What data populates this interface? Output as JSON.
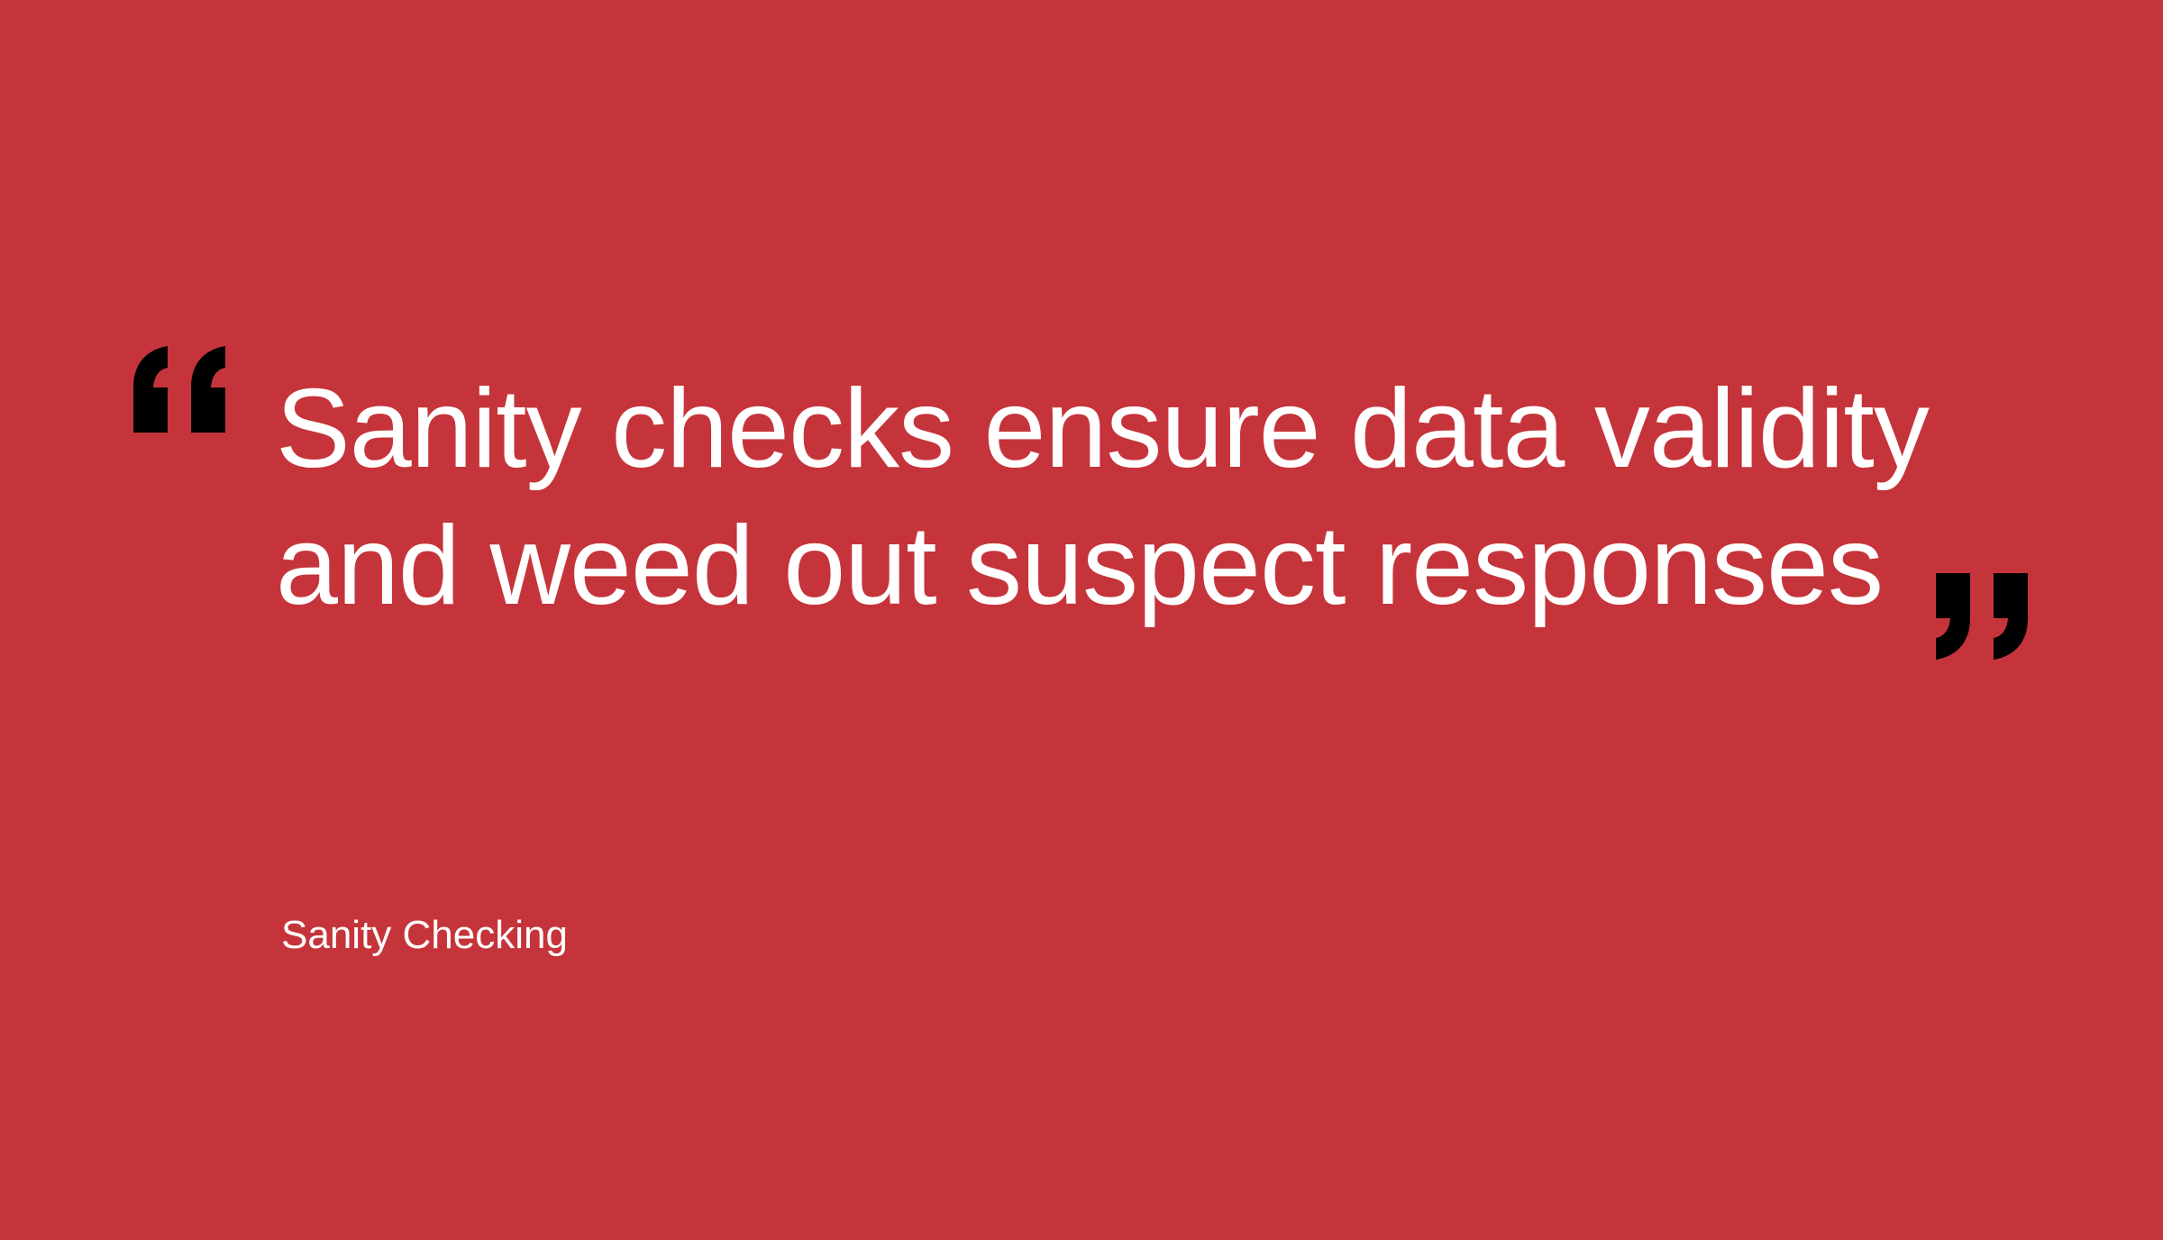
{
  "slide": {
    "quote_lines": [
      "Sanity checks ensure data validity",
      "and weed out suspect responses"
    ],
    "attribution": "Sanity Checking"
  },
  "icons": {
    "open_quote": "open-quote-icon",
    "close_quote": "close-quote-icon"
  },
  "colors": {
    "background": "#c5343a",
    "text": "#ffffff",
    "quote_marks": "#000000"
  }
}
